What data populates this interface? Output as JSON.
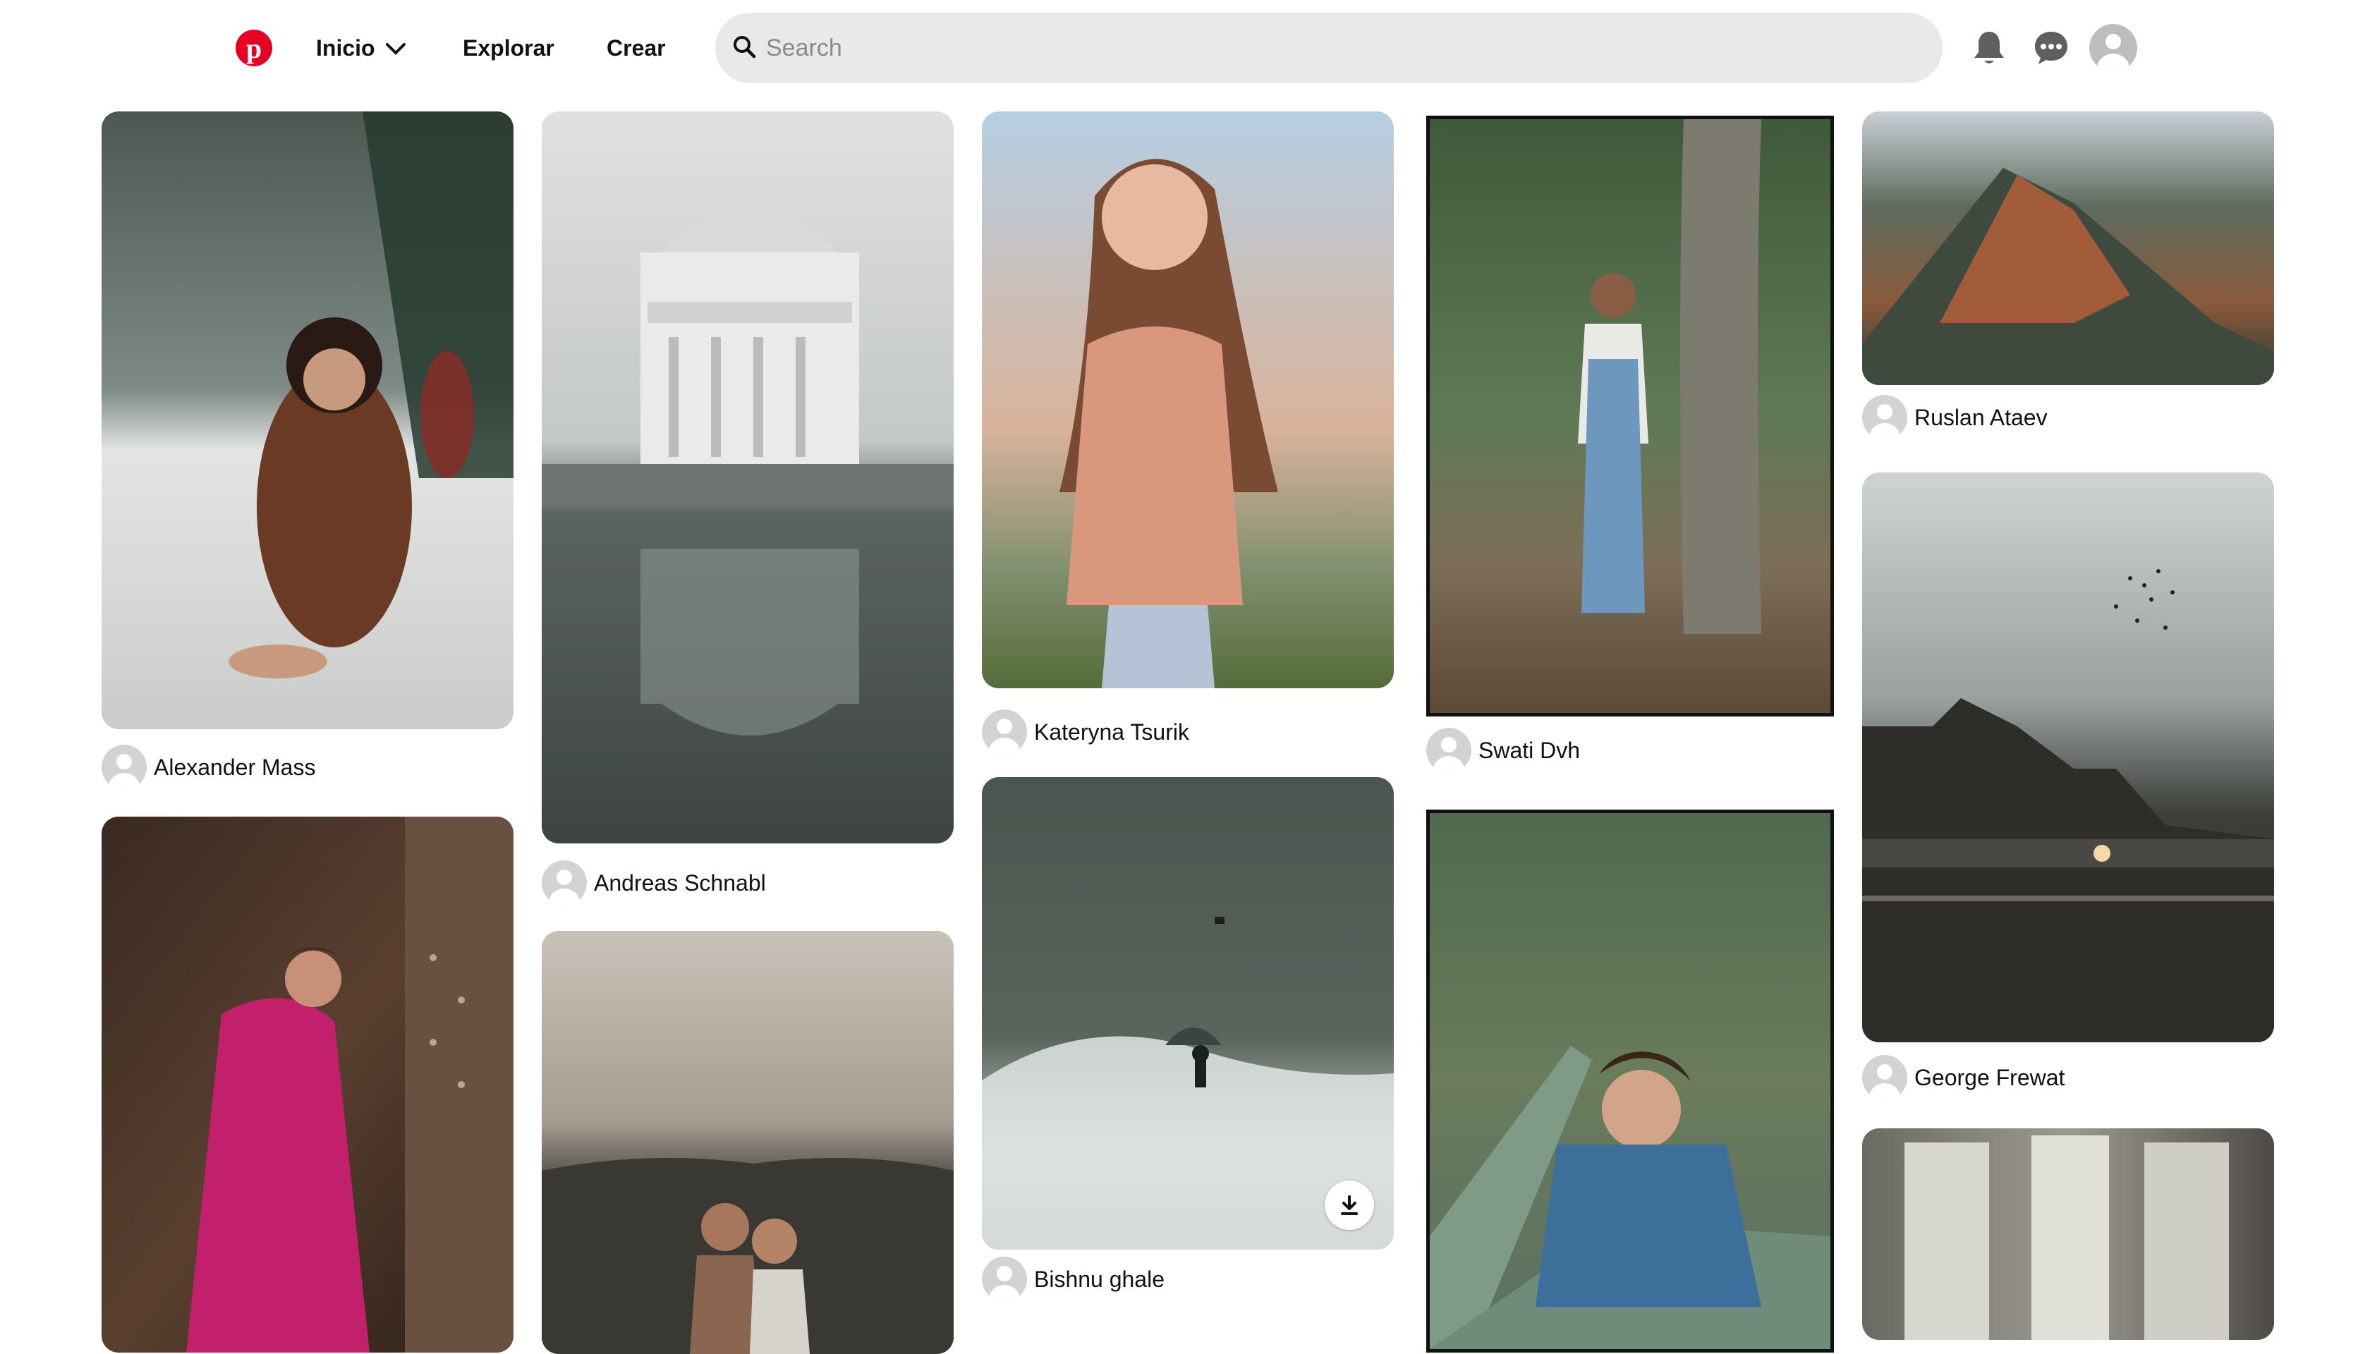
{
  "header": {
    "nav": {
      "home": "Inicio",
      "explore": "Explorar",
      "create": "Crear"
    },
    "search": {
      "placeholder": "Search",
      "value": ""
    }
  },
  "colors": {
    "brand": "#e60023",
    "search_bg": "#e9e9e9"
  },
  "pins": [
    {
      "author": "Alexander Mass"
    },
    {
      "author": "Andreas Schnabl"
    },
    {
      "author": "Kateryna Tsurik"
    },
    {
      "author": "Swati Dvh"
    },
    {
      "author": "Ruslan Ataev"
    },
    {
      "author": "George Frewat"
    },
    {
      "author": "Bishnu ghale"
    }
  ]
}
